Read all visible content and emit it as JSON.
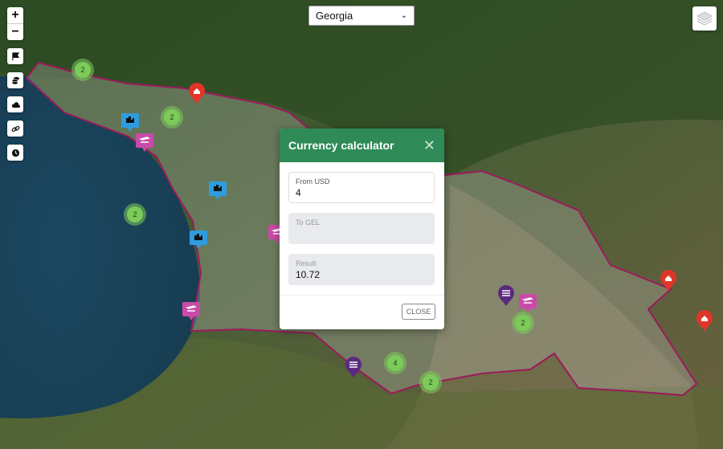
{
  "map": {
    "type": "satellite",
    "highlighted_region": "Georgia",
    "colors": {
      "sea": "#1d4a5f",
      "land": "#3d5b2e",
      "region_outline": "#9b1a5c",
      "region_fill": "rgba(200,200,200,0.28)",
      "cluster": "#7ccb5a",
      "marker_home": "#e0362a",
      "marker_city": "#2d9de0",
      "marker_airport": "#c94aa8",
      "marker_bank": "#5b2a7e"
    },
    "clusters": [
      {
        "id": "c1",
        "count": "2"
      },
      {
        "id": "c2",
        "count": "2"
      },
      {
        "id": "c3",
        "count": "2"
      },
      {
        "id": "c4",
        "count": "2"
      },
      {
        "id": "c5",
        "count": "4"
      },
      {
        "id": "c6",
        "count": "2"
      }
    ],
    "markers": [
      {
        "id": "m1",
        "kind": "home"
      },
      {
        "id": "m2",
        "kind": "home"
      },
      {
        "id": "m3",
        "kind": "home"
      },
      {
        "id": "m4",
        "kind": "city"
      },
      {
        "id": "m5",
        "kind": "airport"
      },
      {
        "id": "m6",
        "kind": "city"
      },
      {
        "id": "m7",
        "kind": "city"
      },
      {
        "id": "m8",
        "kind": "airport"
      },
      {
        "id": "m9",
        "kind": "airport"
      },
      {
        "id": "m10",
        "kind": "bank"
      },
      {
        "id": "m11",
        "kind": "airport"
      },
      {
        "id": "m12",
        "kind": "bank"
      }
    ]
  },
  "controls": {
    "zoom_in": "+",
    "zoom_out": "−",
    "buttons": [
      {
        "name": "flag-icon"
      },
      {
        "name": "coins-icon"
      },
      {
        "name": "cloud-icon"
      },
      {
        "name": "link-icon"
      },
      {
        "name": "clock-icon"
      }
    ]
  },
  "country_select": {
    "selected": "Georgia"
  },
  "layers_button": {
    "icon": "layers-icon"
  },
  "currency_modal": {
    "title": "Currency calculator",
    "from_label": "From USD",
    "from_value": "4",
    "to_label": "To GEL",
    "to_value": "",
    "result_label": "Result",
    "result_value": "10.72",
    "close_label": "CLOSE"
  }
}
